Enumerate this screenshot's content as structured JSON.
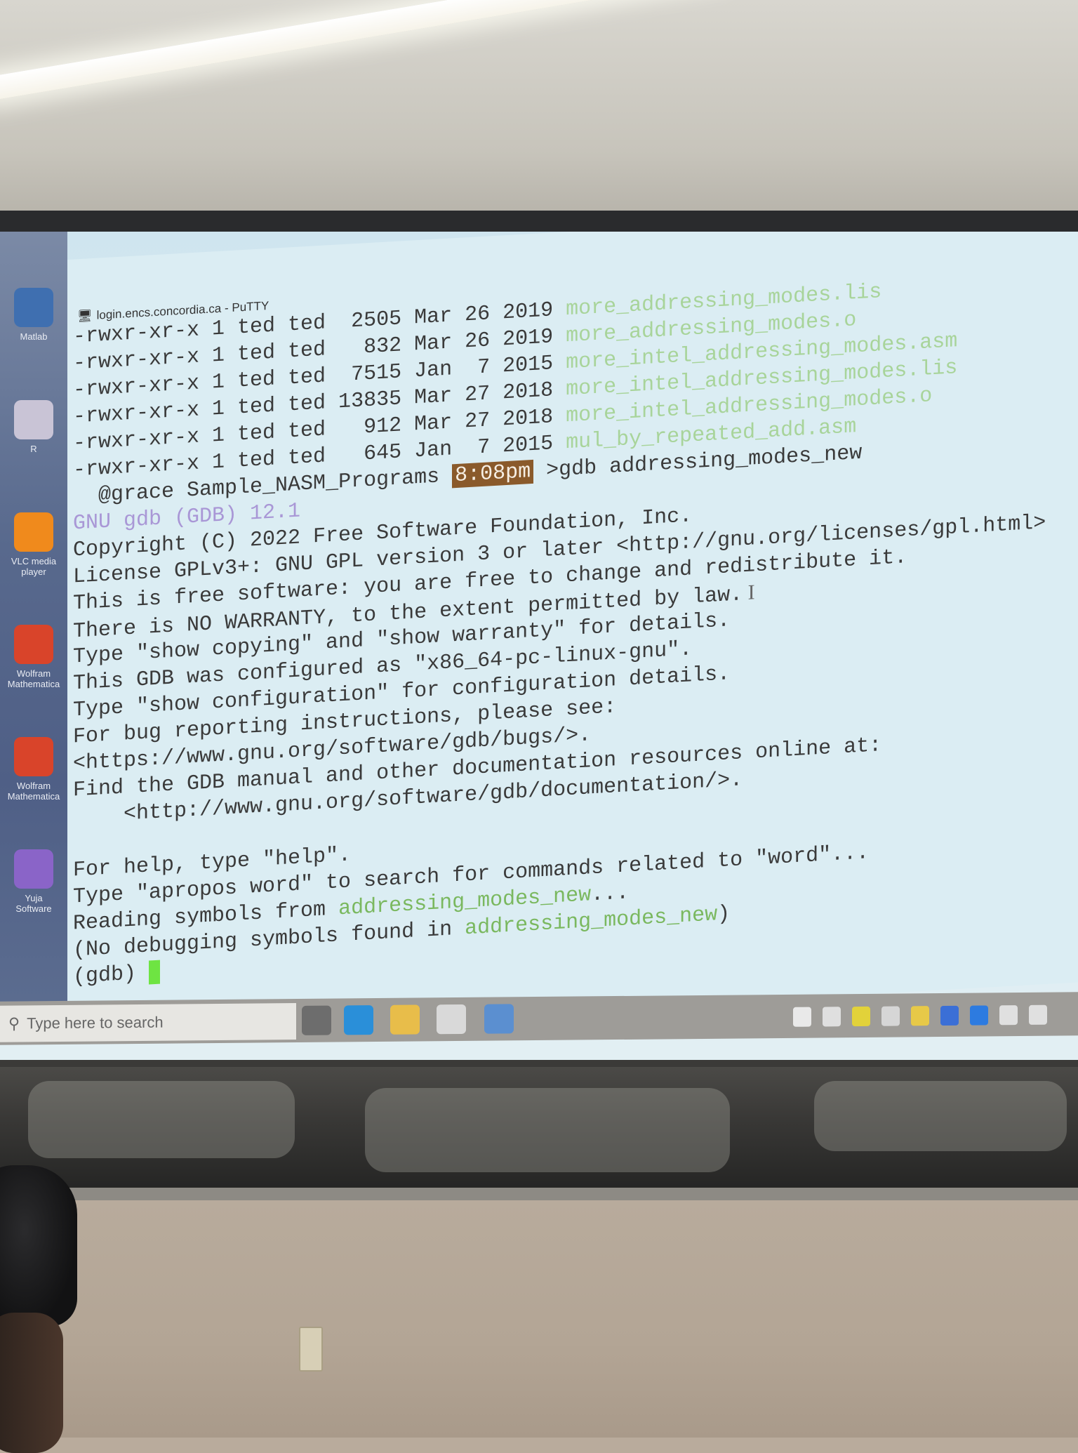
{
  "window": {
    "title": "login.encs.concordia.ca - PuTTY"
  },
  "terminal": {
    "ls_rows": [
      {
        "perms": "-rwxr-xr-x",
        "links": "1",
        "owner": "ted",
        "group": "ted",
        "size": " 2505",
        "month": "Mar",
        "day": "26",
        "year": "2019",
        "name": "more_addressing_modes.lis"
      },
      {
        "perms": "-rwxr-xr-x",
        "links": "1",
        "owner": "ted",
        "group": "ted",
        "size": "  832",
        "month": "Mar",
        "day": "26",
        "year": "2019",
        "name": "more_addressing_modes.o"
      },
      {
        "perms": "-rwxr-xr-x",
        "links": "1",
        "owner": "ted",
        "group": "ted",
        "size": " 7515",
        "month": "Jan",
        "day": " 7",
        "year": "2015",
        "name": "more_intel_addressing_modes.asm"
      },
      {
        "perms": "-rwxr-xr-x",
        "links": "1",
        "owner": "ted",
        "group": "ted",
        "size": "13835",
        "month": "Mar",
        "day": "27",
        "year": "2018",
        "name": "more_intel_addressing_modes.lis"
      },
      {
        "perms": "-rwxr-xr-x",
        "links": "1",
        "owner": "ted",
        "group": "ted",
        "size": "  912",
        "month": "Mar",
        "day": "27",
        "year": "2018",
        "name": "more_intel_addressing_modes.o"
      },
      {
        "perms": "-rwxr-xr-x",
        "links": "1",
        "owner": "ted",
        "group": "ted",
        "size": "  645",
        "month": "Jan",
        "day": " 7",
        "year": "2015",
        "name": "mul_by_repeated_add.asm"
      }
    ],
    "prompt_host": "@grace",
    "prompt_dir": "Sample_NASM_Programs",
    "prompt_time": "8:08pm",
    "prompt_cmd": ">gdb addressing_modes_new",
    "gdb_version": "GNU gdb (GDB) 12.1",
    "lines": [
      "Copyright (C) 2022 Free Software Foundation, Inc.",
      "License GPLv3+: GNU GPL version 3 or later <http://gnu.org/licenses/gpl.html>",
      "This is free software: you are free to change and redistribute it.",
      "There is NO WARRANTY, to the extent permitted by law.",
      "Type \"show copying\" and \"show warranty\" for details.",
      "This GDB was configured as \"x86_64-pc-linux-gnu\".",
      "Type \"show configuration\" for configuration details.",
      "For bug reporting instructions, please see:",
      "<https://www.gnu.org/software/gdb/bugs/>.",
      "Find the GDB manual and other documentation resources online at:",
      "    <http://www.gnu.org/software/gdb/documentation/>.",
      "",
      "For help, type \"help\".",
      "Type \"apropos word\" to search for commands related to \"word\"..."
    ],
    "reading_prefix": "Reading symbols from ",
    "reading_file": "addressing_modes_new",
    "reading_suffix": "...",
    "nodebug_prefix": "(No debugging symbols found in ",
    "nodebug_file": "addressing_modes_new",
    "nodebug_suffix": ")",
    "gdb_prompt": "(gdb) "
  },
  "desktop_icons": [
    {
      "label": "Matlab",
      "icon": "matlab-icon",
      "color": "#3f6fb0"
    },
    {
      "label": "R",
      "icon": "r-icon",
      "color": "#c9c4d6"
    },
    {
      "label": "VLC media player",
      "icon": "vlc-icon",
      "color": "#f08a1c"
    },
    {
      "label": "Wolfram Mathematica",
      "icon": "wolfram-icon",
      "color": "#d9442a"
    },
    {
      "label": "Wolfram Mathematica",
      "icon": "wolfram-icon",
      "color": "#d9442a"
    },
    {
      "label": "Yuja Software",
      "icon": "yuja-icon",
      "color": "#8a64c8"
    }
  ],
  "taskbar": {
    "search_placeholder": "Type here to search",
    "apps": [
      {
        "icon": "task-view-icon",
        "color": "#6d6d6d"
      },
      {
        "icon": "edge-icon",
        "color": "#2a8fd9"
      },
      {
        "icon": "file-explorer-icon",
        "color": "#e8bd4a"
      },
      {
        "icon": "store-icon",
        "color": "#d9d9d9"
      },
      {
        "icon": "network-app-icon",
        "color": "#5b8fd0"
      }
    ],
    "tray": [
      {
        "icon": "news-widget-icon",
        "color": "#e9e9e9"
      },
      {
        "icon": "app-tray-icon",
        "color": "#dfdfdf"
      },
      {
        "icon": "lemon-icon",
        "color": "#e2d23a"
      },
      {
        "icon": "cloud-offline-icon",
        "color": "#d6d6d6"
      },
      {
        "icon": "chat-icon",
        "color": "#e7c948"
      },
      {
        "icon": "security-shield-icon",
        "color": "#3b6fd6"
      },
      {
        "icon": "bluetooth-icon",
        "color": "#2d7be0"
      },
      {
        "icon": "usb-icon",
        "color": "#e0e0e0"
      },
      {
        "icon": "monitor-icon",
        "color": "#e0e0e0"
      }
    ]
  }
}
